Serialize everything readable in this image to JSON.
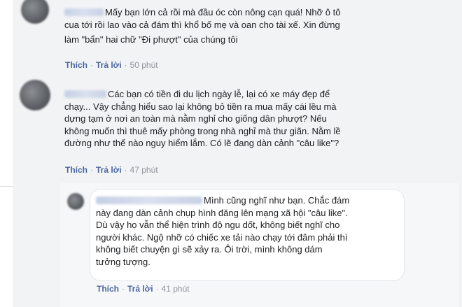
{
  "comments": [
    {
      "text_line1": "Mấy bạn lớn cả rồi mà đầu óc còn nông cạn quá! Nhỡ ô tô",
      "text_line2": "cua tới rồi lao vào cả đám thì khổ bố mẹ và oan cho tài xế. Xin đừng",
      "text_line3": "làm \"bẩn\" hai chữ \"Đi phượt\" của chúng tôi",
      "like_label": "Thích",
      "reply_label": "Trả lời",
      "time": "50 phút"
    },
    {
      "text_line1": "Các bạn có tiền đi du lịch ngày lễ, lại có xe máy đẹp để",
      "text_line2": "chạy... Vậy chẳng hiểu sao lại không bỏ tiền ra mua mấy cái lều mà",
      "text_line3": "dựng tạm ở nơi an toàn mà nằm nghỉ cho giống dân phượt? Nếu",
      "text_line4": "không muốn thì thuê mấy phòng trong nhà nghỉ mà thư giãn. Nằm lề",
      "text_line5": "đường như thế nào nguy hiểm lắm. Có lẽ đang dàn cảnh \"câu like\"?",
      "like_label": "Thích",
      "reply_label": "Trả lời",
      "time": "47 phút"
    },
    {
      "text_line1": "Mình cũng nghĩ như bạn. Chắc đám",
      "text_line2": "này đang dàn cảnh chụp hình đăng lên mạng xã hội \"câu like\".",
      "text_line3": "Dù vậy họ vẫn thể hiện trình độ ngu dốt, không biết nghĩ cho",
      "text_line4": "người khác. Ngộ nhỡ có chiếc xe tải nào chạy tới đâm phải thì",
      "text_line5": "không biết chuyện gì sẽ xảy ra. Ôi trời, mình không dám",
      "text_line6": "tưởng tượng.",
      "like_label": "Thích",
      "reply_label": "Trả lời",
      "time": "41 phút"
    }
  ]
}
